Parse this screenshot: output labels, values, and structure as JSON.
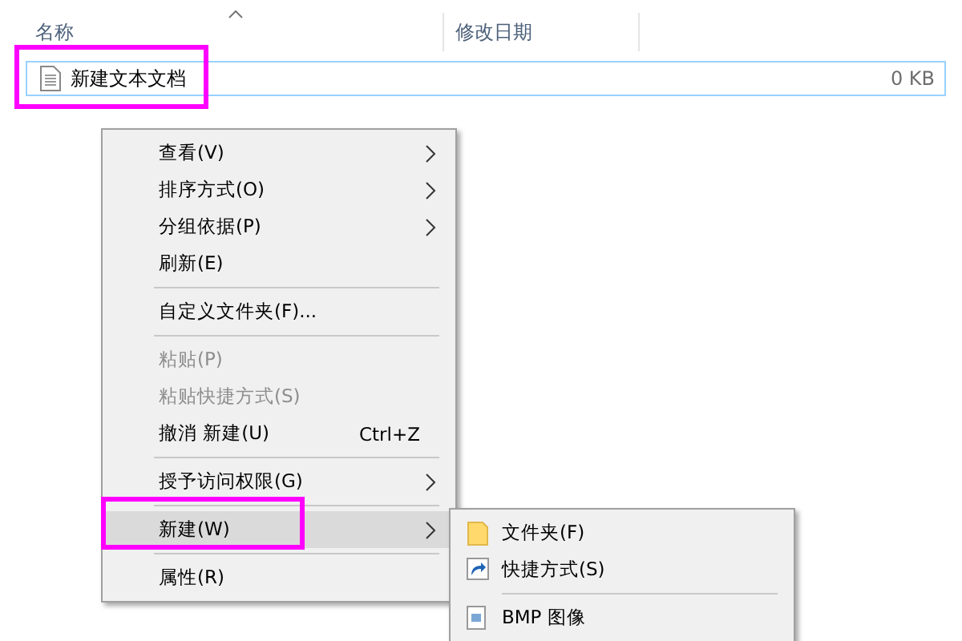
{
  "file_list": {
    "columns": [
      {
        "label": "名称",
        "sorted": true
      },
      {
        "label": "修改日期",
        "sorted": false
      }
    ],
    "rows": [
      {
        "name": "新建文本文档",
        "size": "0 KB",
        "selected": true,
        "annotated": true
      }
    ]
  },
  "context_menu": {
    "items": [
      {
        "kind": "item",
        "label": "查看(V)",
        "submenu": true,
        "disabled": false,
        "selected": false,
        "annotated": false
      },
      {
        "kind": "item",
        "label": "排序方式(O)",
        "submenu": true,
        "disabled": false,
        "selected": false,
        "annotated": false
      },
      {
        "kind": "item",
        "label": "分组依据(P)",
        "submenu": true,
        "disabled": false,
        "selected": false,
        "annotated": false
      },
      {
        "kind": "item",
        "label": "刷新(E)",
        "submenu": false,
        "disabled": false,
        "selected": false,
        "annotated": false
      },
      {
        "kind": "separator"
      },
      {
        "kind": "item",
        "label": "自定义文件夹(F)...",
        "submenu": false,
        "disabled": false,
        "selected": false,
        "annotated": false
      },
      {
        "kind": "separator"
      },
      {
        "kind": "item",
        "label": "粘贴(P)",
        "submenu": false,
        "disabled": true,
        "selected": false,
        "annotated": false
      },
      {
        "kind": "item",
        "label": "粘贴快捷方式(S)",
        "submenu": false,
        "disabled": true,
        "selected": false,
        "annotated": false
      },
      {
        "kind": "item",
        "label": "撤消 新建(U)",
        "shortcut": "Ctrl+Z",
        "submenu": false,
        "disabled": false,
        "selected": false,
        "annotated": false
      },
      {
        "kind": "separator"
      },
      {
        "kind": "item",
        "label": "授予访问权限(G)",
        "submenu": true,
        "disabled": false,
        "selected": false,
        "annotated": false
      },
      {
        "kind": "separator"
      },
      {
        "kind": "item",
        "label": "新建(W)",
        "submenu": true,
        "disabled": false,
        "selected": true,
        "annotated": true
      },
      {
        "kind": "separator"
      },
      {
        "kind": "item",
        "label": "属性(R)",
        "submenu": false,
        "disabled": false,
        "selected": false,
        "annotated": false
      }
    ]
  },
  "new_submenu": {
    "items": [
      {
        "kind": "folder",
        "label": "文件夹(F)"
      },
      {
        "kind": "shortcut",
        "label": "快捷方式(S)"
      },
      {
        "kind": "separator"
      },
      {
        "kind": "bmp",
        "label": "BMP 图像"
      }
    ]
  }
}
